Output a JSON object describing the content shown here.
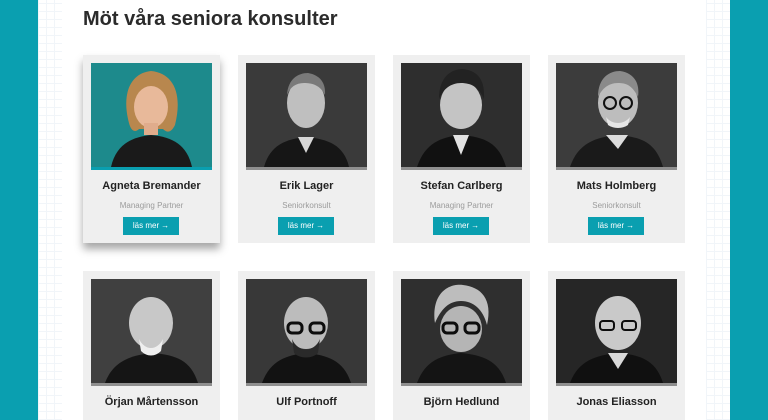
{
  "page": {
    "heading": "Möt våra seniora konsulter"
  },
  "consultants": [
    {
      "name": "Agneta Bremander",
      "role": "Managing Partner",
      "button": "läs mer",
      "photo": "portrait-woman-color"
    },
    {
      "name": "Erik Lager",
      "role": "Seniorkonsult",
      "button": "läs mer",
      "photo": "portrait-man-bw"
    },
    {
      "name": "Stefan Carlberg",
      "role": "Managing Partner",
      "button": "läs mer",
      "photo": "portrait-man-bw"
    },
    {
      "name": "Mats Holmberg",
      "role": "Seniorkonsult",
      "button": "läs mer",
      "photo": "portrait-man-glasses-bw"
    },
    {
      "name": "Örjan Mårtensson",
      "role": "",
      "button": "",
      "photo": "portrait-man-bald-bw"
    },
    {
      "name": "Ulf Portnoff",
      "role": "",
      "button": "",
      "photo": "portrait-man-glasses-bw"
    },
    {
      "name": "Björn Hedlund",
      "role": "",
      "button": "",
      "photo": "portrait-man-glasses-bw"
    },
    {
      "name": "Jonas Eliasson",
      "role": "",
      "button": "",
      "photo": "portrait-man-glasses-bw"
    }
  ],
  "colors": {
    "accent": "#0a9fb0",
    "card": "#efefef",
    "heading": "#2b2b2b"
  }
}
